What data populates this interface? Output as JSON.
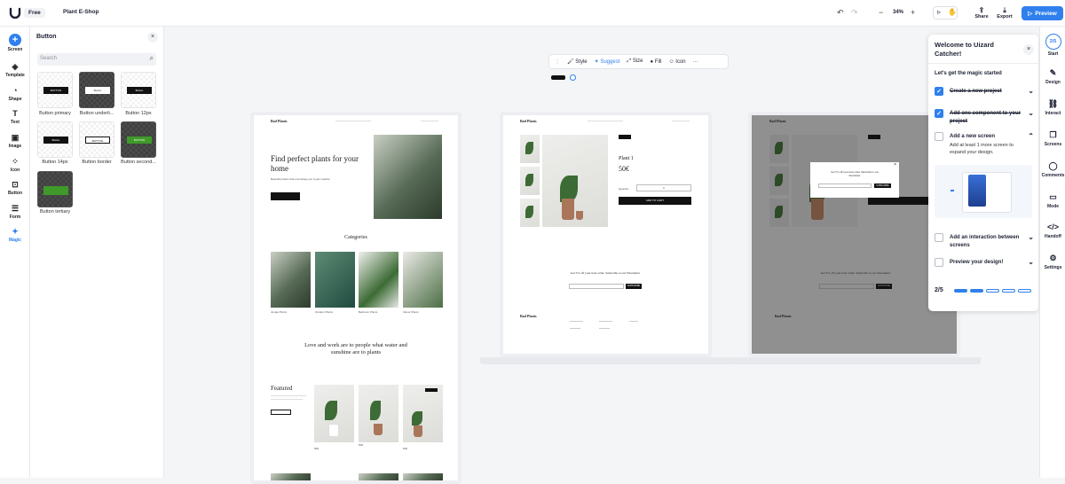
{
  "topbar": {
    "plan": "Free",
    "project": "Plant E-Shop",
    "zoom": "34%",
    "share": "Share",
    "export": "Export",
    "preview": "Preview"
  },
  "left_rail": [
    {
      "name": "screen",
      "label": "Screen",
      "icon": "plus-icon"
    },
    {
      "name": "template",
      "label": "Template",
      "icon": "layers-icon"
    },
    {
      "name": "shape",
      "label": "Shape",
      "icon": "shape-icon"
    },
    {
      "name": "text",
      "label": "Text",
      "icon": "text-icon"
    },
    {
      "name": "image",
      "label": "Image",
      "icon": "image-icon"
    },
    {
      "name": "icon",
      "label": "Icon",
      "icon": "icon-icon"
    },
    {
      "name": "button",
      "label": "Button",
      "icon": "button-icon"
    },
    {
      "name": "form",
      "label": "Form",
      "icon": "form-icon"
    },
    {
      "name": "magic",
      "label": "Magic",
      "icon": "magic-icon"
    }
  ],
  "panel": {
    "title": "Button",
    "search_placeholder": "Search",
    "items": [
      {
        "label": "Button primary",
        "preview": "BUTTON"
      },
      {
        "label": "Button underli...",
        "preview": "Button"
      },
      {
        "label": "Button 12px",
        "preview": "Button"
      },
      {
        "label": "Button 14px",
        "preview": "Button"
      },
      {
        "label": "Button border",
        "preview": "BUTTON"
      },
      {
        "label": "Button second...",
        "preview": "BUTTON"
      },
      {
        "label": "Button tertiary",
        "preview": ""
      }
    ]
  },
  "canvas_toolbar": {
    "style": "Style",
    "suggest": "Suggest",
    "size": "Size",
    "fill": "Fill",
    "icon": "Icon",
    "more": "···"
  },
  "screens": {
    "brand": "Bad Plants",
    "hero_title": "Find perfect plants  for your home",
    "hero_sub": "Beautiful plants that encourage you to get creative",
    "categories_title": "Categories",
    "categories": [
      "Jungle Plants",
      "Outdoor Plants",
      "Bedroom Plants",
      "Indoor Plants"
    ],
    "quote": "Love and work are to people what water and sunshine are to plants",
    "featured": "Featured",
    "prices": [
      "50€",
      "50€",
      "50€"
    ],
    "product_name": "Plant 1",
    "product_price": "50€",
    "quantity_label": "Quantity",
    "quantity_value": "1",
    "add_to_cart": "ADD TO CART",
    "newsletter": "Get 5% off your next order.  Subscribe to our Newsletter",
    "subscribe": "SUBSCRIBE",
    "buy": "BUY"
  },
  "welcome": {
    "title": "Welcome to Uizard Catcher!",
    "subtitle": "Let's get the magic started",
    "steps": [
      {
        "label": "Create a new project",
        "done": true,
        "desc": ""
      },
      {
        "label": "Add one component to your project",
        "done": true,
        "desc": ""
      },
      {
        "label": "Add a new screen",
        "done": false,
        "desc": "Add at least 1 more screen to expand your design."
      },
      {
        "label": "Add an interaction between screens",
        "done": false,
        "desc": ""
      },
      {
        "label": "Preview your design!",
        "done": false,
        "desc": ""
      }
    ],
    "progress": "2/5",
    "progress_value": 0.4
  },
  "right_rail": [
    {
      "name": "start",
      "label": "Start",
      "badge": "2/5"
    },
    {
      "name": "design",
      "label": "Design",
      "icon": "pencil-icon"
    },
    {
      "name": "interact",
      "label": "Interact",
      "icon": "link-icon"
    },
    {
      "name": "screens",
      "label": "Screens",
      "icon": "screens-icon"
    },
    {
      "name": "comments",
      "label": "Comments",
      "icon": "comment-icon"
    },
    {
      "name": "mode",
      "label": "Mode",
      "icon": "mode-icon"
    },
    {
      "name": "handoff",
      "label": "Handoff",
      "icon": "code-icon"
    },
    {
      "name": "settings",
      "label": "Settings",
      "icon": "settings-icon"
    }
  ],
  "colors": {
    "accent": "#2f80ed",
    "dark": "#111111"
  }
}
